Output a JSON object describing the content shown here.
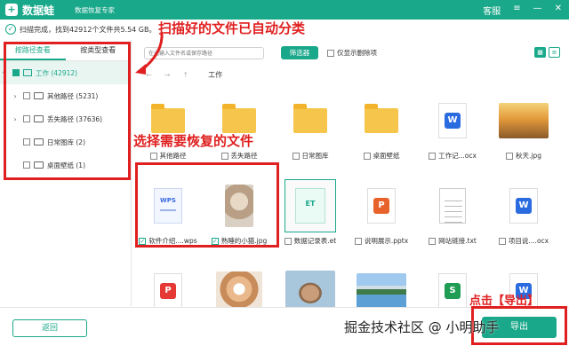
{
  "titlebar": {
    "logo_glyph": "+",
    "app_name": "数据蛙",
    "subtitle": "数据恢复专家",
    "menu": [
      "客服",
      "≡",
      "—",
      "✕"
    ]
  },
  "status": {
    "icon": "check-circle-icon",
    "text": "扫描完成，找到42912个文件共5.54 GB。"
  },
  "sidebar": {
    "tabs": [
      {
        "label": "按路径查看",
        "active": true
      },
      {
        "label": "按类型查看",
        "active": false
      }
    ],
    "tree": [
      {
        "label": "工作 (42912)",
        "root": true
      },
      {
        "label": "其他路径 (5231)",
        "expandable": true
      },
      {
        "label": "丢失路径 (37636)",
        "expandable": true
      },
      {
        "label": "日常图库 (2)",
        "expandable": false
      },
      {
        "label": "桌面壁纸 (1)",
        "expandable": false
      }
    ]
  },
  "toolbar": {
    "search_placeholder": "在此输入文件名或保存路径",
    "filter_label": "筛选器",
    "show_deleted_label": "仅显示删除项",
    "view_icons": [
      "grid-view-icon",
      "list-view-icon"
    ]
  },
  "pathbar": {
    "back": "←",
    "forward": "→",
    "up": "↑",
    "crumb": "工作"
  },
  "files": [
    {
      "name": "其他路径",
      "kind": "folder"
    },
    {
      "name": "丢失路径",
      "kind": "folder"
    },
    {
      "name": "日常图库",
      "kind": "folder"
    },
    {
      "name": "桌面壁纸",
      "kind": "folder"
    },
    {
      "name": "工作记...ocx",
      "kind": "word"
    },
    {
      "name": "秋天.jpg",
      "kind": "photo-autumn"
    },
    {
      "name": "软件介绍....wps",
      "kind": "wps",
      "checked": true
    },
    {
      "name": "熟睡的小猫.jpg",
      "kind": "photo-cat",
      "checked": true
    },
    {
      "name": "数据记录表.et",
      "kind": "et"
    },
    {
      "name": "说明展示.pptx",
      "kind": "ppt"
    },
    {
      "name": "网站链接.txt",
      "kind": "txt"
    },
    {
      "name": "项目说....ocx",
      "kind": "word"
    },
    {
      "name": "",
      "kind": "pdf"
    },
    {
      "name": "",
      "kind": "photo-kitten"
    },
    {
      "name": "",
      "kind": "photo-bunny"
    },
    {
      "name": "",
      "kind": "photo-lake"
    },
    {
      "name": "",
      "kind": "xls"
    },
    {
      "name": "",
      "kind": "word"
    }
  ],
  "footer": {
    "back_label": "返回",
    "export_label": "导出"
  },
  "annotations": {
    "scanned": "扫描好的文件已自动分类",
    "choose": "选择需要恢复的文件",
    "export": "点击【导出】",
    "color": "#e02020"
  },
  "watermark": "掘金技术社区 @ 小明助手"
}
